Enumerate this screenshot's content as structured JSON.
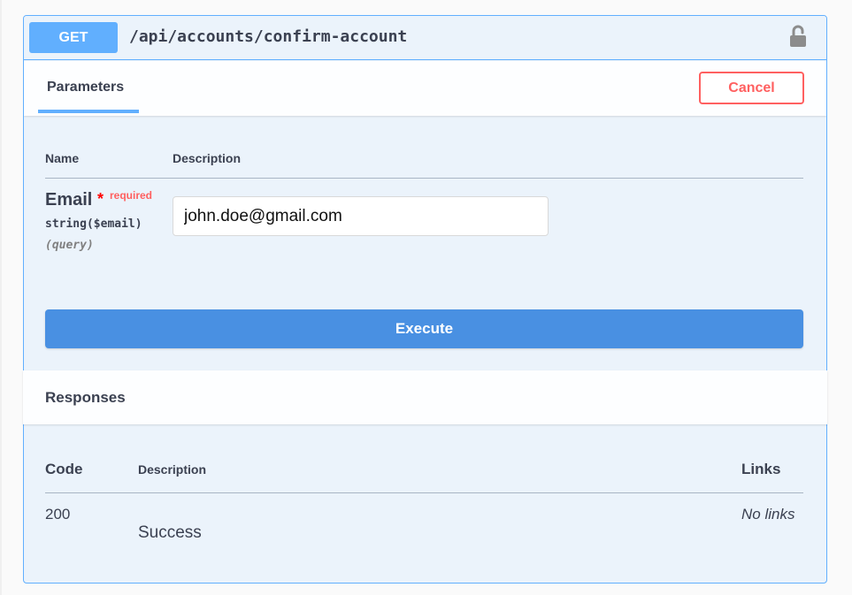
{
  "operation": {
    "method": "GET",
    "path": "/api/accounts/confirm-account",
    "lock_icon": "unlocked-padlock-icon"
  },
  "tabs": {
    "parameters_label": "Parameters",
    "cancel_label": "Cancel"
  },
  "parameters": {
    "headers": {
      "name": "Name",
      "description": "Description"
    },
    "items": [
      {
        "name": "Email",
        "required_marker": "*",
        "required_label": "required",
        "type": "string($email)",
        "location": "(query)",
        "value": "john.doe@gmail.com"
      }
    ]
  },
  "execute_label": "Execute",
  "responses": {
    "title": "Responses",
    "headers": {
      "code": "Code",
      "description": "Description",
      "links": "Links"
    },
    "rows": [
      {
        "code": "200",
        "description": "Success",
        "links": "No links"
      }
    ]
  },
  "colors": {
    "get_accent": "#61affe",
    "get_background": "#ebf3fb",
    "execute_blue": "#4990e2",
    "cancel_red": "#ff6060"
  }
}
